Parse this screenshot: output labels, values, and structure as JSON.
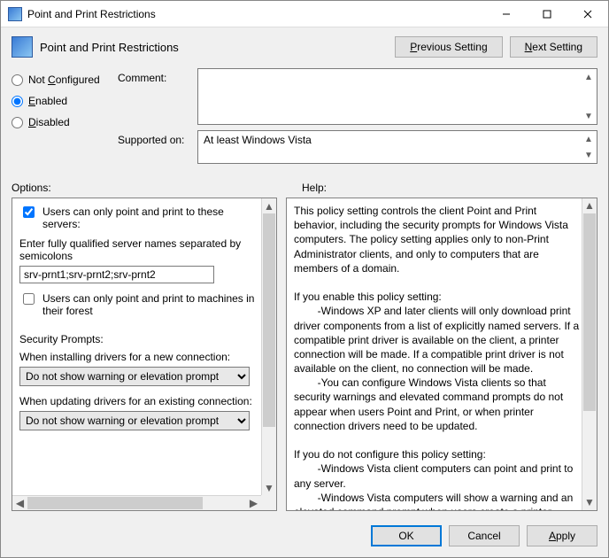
{
  "titlebar": {
    "title": "Point and Print Restrictions"
  },
  "header": {
    "title": "Point and Print Restrictions",
    "prev": "Previous Setting",
    "next": "Next Setting"
  },
  "state": {
    "not_configured": "Not Configured",
    "enabled": "Enabled",
    "disabled": "Disabled",
    "selected": "enabled",
    "nc_mn": "C",
    "en_mn": "E",
    "di_mn": "D"
  },
  "comment": {
    "label": "Comment:",
    "value": ""
  },
  "supported": {
    "label": "Supported on:",
    "value": "At least Windows Vista"
  },
  "sections": {
    "options": "Options:",
    "help": "Help:"
  },
  "options": {
    "chk_servers": "Users can only point and print to these servers:",
    "chk_servers_checked": true,
    "enter_label": "Enter fully qualified server names separated by semicolons",
    "servers_value": "srv-prnt1;srv-prnt2;srv-prnt2",
    "chk_forest": "Users can only point and print to machines in their forest",
    "chk_forest_checked": false,
    "sec_prompts": "Security Prompts:",
    "install_label": "When installing drivers for a new connection:",
    "install_value": "Do not show warning or elevation prompt",
    "update_label": "When updating drivers for an existing connection:",
    "update_value": "Do not show warning or elevation prompt"
  },
  "help_text": "This policy setting controls the client Point and Print behavior, including the security prompts for Windows Vista computers. The policy setting applies only to non-Print Administrator clients, and only to computers that are members of a domain.\n\nIf you enable this policy setting:\n        -Windows XP and later clients will only download print driver components from a list of explicitly named servers. If a compatible print driver is available on the client, a printer connection will be made. If a compatible print driver is not available on the client, no connection will be made.\n        -You can configure Windows Vista clients so that security warnings and elevated command prompts do not appear when users Point and Print, or when printer connection drivers need to be updated.\n\nIf you do not configure this policy setting:\n        -Windows Vista client computers can point and print to any server.\n        -Windows Vista computers will show a warning and an elevated command prompt when users create a printer",
  "footer": {
    "ok": "OK",
    "cancel": "Cancel",
    "apply": "Apply",
    "apply_mn": "A"
  }
}
